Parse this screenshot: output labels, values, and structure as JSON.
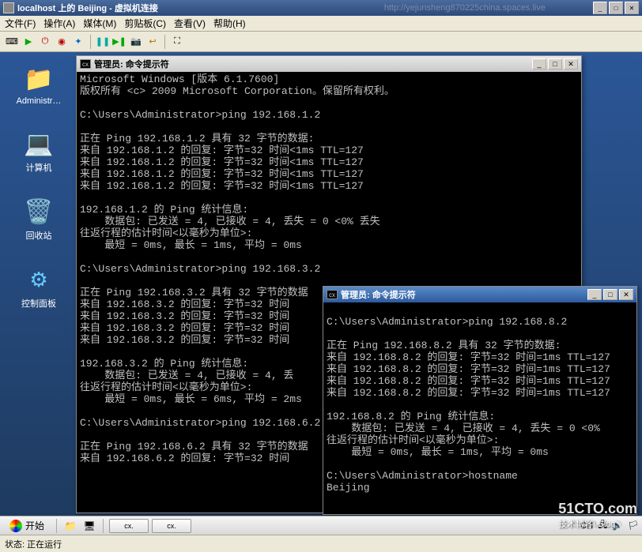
{
  "outer": {
    "title": "localhost 上的 Beijing - 虚拟机连接",
    "url": "http://yejunsheng870225china.spaces.live"
  },
  "menu": {
    "file": "文件(F)",
    "action": "操作(A)",
    "media": "媒体(M)",
    "clipboard": "剪贴板(C)",
    "view": "查看(V)",
    "help": "帮助(H)"
  },
  "desktop": {
    "admin": "Administr…",
    "computer": "计算机",
    "recycle": "回收站",
    "panel": "控制面板"
  },
  "cmd": {
    "title": "管理员: 命令提示符"
  },
  "console1": "Microsoft Windows [版本 6.1.7600]\n版权所有 <c> 2009 Microsoft Corporation。保留所有权利。\n\nC:\\Users\\Administrator>ping 192.168.1.2\n\n正在 Ping 192.168.1.2 具有 32 字节的数据:\n来自 192.168.1.2 的回复: 字节=32 时间<1ms TTL=127\n来自 192.168.1.2 的回复: 字节=32 时间<1ms TTL=127\n来自 192.168.1.2 的回复: 字节=32 时间<1ms TTL=127\n来自 192.168.1.2 的回复: 字节=32 时间<1ms TTL=127\n\n192.168.1.2 的 Ping 统计信息:\n    数据包: 已发送 = 4, 已接收 = 4, 丢失 = 0 <0% 丢失\n往返行程的估计时间<以毫秒为单位>:\n    最短 = 0ms, 最长 = 1ms, 平均 = 0ms\n\nC:\\Users\\Administrator>ping 192.168.3.2\n\n正在 Ping 192.168.3.2 具有 32 字节的数据\n来自 192.168.3.2 的回复: 字节=32 时间\n来自 192.168.3.2 的回复: 字节=32 时间\n来自 192.168.3.2 的回复: 字节=32 时间\n来自 192.168.3.2 的回复: 字节=32 时间\n\n192.168.3.2 的 Ping 统计信息:\n    数据包: 已发送 = 4, 已接收 = 4, 丢\n往返行程的估计时间<以毫秒为单位>:\n    最短 = 0ms, 最长 = 6ms, 平均 = 2ms\n\nC:\\Users\\Administrator>ping 192.168.6.2\n\n正在 Ping 192.168.6.2 具有 32 字节的数据\n来自 192.168.6.2 的回复: 字节=32 时间",
  "console2": "\nC:\\Users\\Administrator>ping 192.168.8.2\n\n正在 Ping 192.168.8.2 具有 32 字节的数据:\n来自 192.168.8.2 的回复: 字节=32 时间=1ms TTL=127\n来自 192.168.8.2 的回复: 字节=32 时间=1ms TTL=127\n来自 192.168.8.2 的回复: 字节=32 时间=1ms TTL=127\n来自 192.168.8.2 的回复: 字节=32 时间=1ms TTL=127\n\n192.168.8.2 的 Ping 统计信息:\n    数据包: 已发送 = 4, 已接收 = 4, 丢失 = 0 <0%\n往返行程的估计时间<以毫秒为单位>:\n    最短 = 0ms, 最长 = 1ms, 平均 = 0ms\n\nC:\\Users\\Administrator>hostname\nBeijing",
  "taskbar": {
    "start": "开始",
    "lang": "CH"
  },
  "status": {
    "label": "状态:",
    "value": "正在运行"
  },
  "watermark": {
    "main": "51CTO.com",
    "sub": "技术博客\\ Blog"
  }
}
